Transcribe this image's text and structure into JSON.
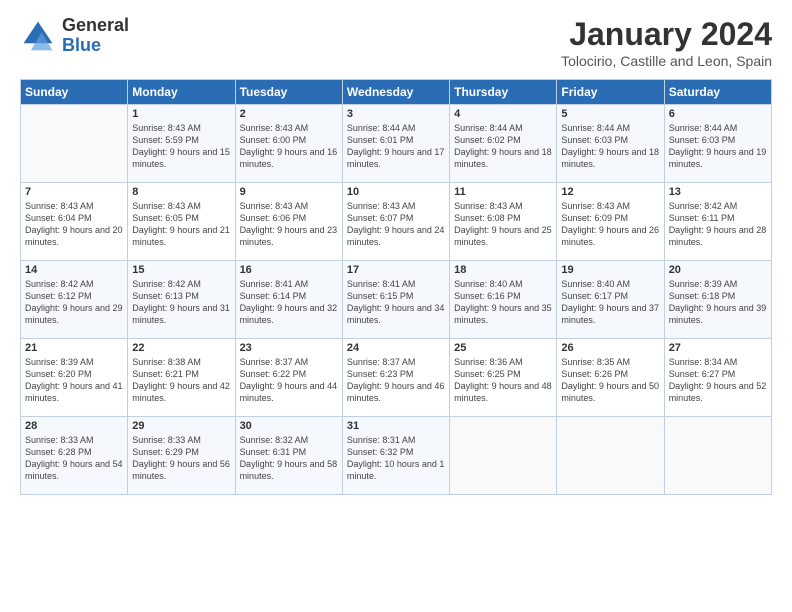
{
  "logo": {
    "general": "General",
    "blue": "Blue"
  },
  "header": {
    "month_year": "January 2024",
    "location": "Tolocirio, Castille and Leon, Spain"
  },
  "days_of_week": [
    "Sunday",
    "Monday",
    "Tuesday",
    "Wednesday",
    "Thursday",
    "Friday",
    "Saturday"
  ],
  "weeks": [
    [
      {
        "day": "",
        "sunrise": "",
        "sunset": "",
        "daylight": ""
      },
      {
        "day": "1",
        "sunrise": "Sunrise: 8:43 AM",
        "sunset": "Sunset: 5:59 PM",
        "daylight": "Daylight: 9 hours and 15 minutes."
      },
      {
        "day": "2",
        "sunrise": "Sunrise: 8:43 AM",
        "sunset": "Sunset: 6:00 PM",
        "daylight": "Daylight: 9 hours and 16 minutes."
      },
      {
        "day": "3",
        "sunrise": "Sunrise: 8:44 AM",
        "sunset": "Sunset: 6:01 PM",
        "daylight": "Daylight: 9 hours and 17 minutes."
      },
      {
        "day": "4",
        "sunrise": "Sunrise: 8:44 AM",
        "sunset": "Sunset: 6:02 PM",
        "daylight": "Daylight: 9 hours and 18 minutes."
      },
      {
        "day": "5",
        "sunrise": "Sunrise: 8:44 AM",
        "sunset": "Sunset: 6:03 PM",
        "daylight": "Daylight: 9 hours and 18 minutes."
      },
      {
        "day": "6",
        "sunrise": "Sunrise: 8:44 AM",
        "sunset": "Sunset: 6:03 PM",
        "daylight": "Daylight: 9 hours and 19 minutes."
      }
    ],
    [
      {
        "day": "7",
        "sunrise": "Sunrise: 8:43 AM",
        "sunset": "Sunset: 6:04 PM",
        "daylight": "Daylight: 9 hours and 20 minutes."
      },
      {
        "day": "8",
        "sunrise": "Sunrise: 8:43 AM",
        "sunset": "Sunset: 6:05 PM",
        "daylight": "Daylight: 9 hours and 21 minutes."
      },
      {
        "day": "9",
        "sunrise": "Sunrise: 8:43 AM",
        "sunset": "Sunset: 6:06 PM",
        "daylight": "Daylight: 9 hours and 23 minutes."
      },
      {
        "day": "10",
        "sunrise": "Sunrise: 8:43 AM",
        "sunset": "Sunset: 6:07 PM",
        "daylight": "Daylight: 9 hours and 24 minutes."
      },
      {
        "day": "11",
        "sunrise": "Sunrise: 8:43 AM",
        "sunset": "Sunset: 6:08 PM",
        "daylight": "Daylight: 9 hours and 25 minutes."
      },
      {
        "day": "12",
        "sunrise": "Sunrise: 8:43 AM",
        "sunset": "Sunset: 6:09 PM",
        "daylight": "Daylight: 9 hours and 26 minutes."
      },
      {
        "day": "13",
        "sunrise": "Sunrise: 8:42 AM",
        "sunset": "Sunset: 6:11 PM",
        "daylight": "Daylight: 9 hours and 28 minutes."
      }
    ],
    [
      {
        "day": "14",
        "sunrise": "Sunrise: 8:42 AM",
        "sunset": "Sunset: 6:12 PM",
        "daylight": "Daylight: 9 hours and 29 minutes."
      },
      {
        "day": "15",
        "sunrise": "Sunrise: 8:42 AM",
        "sunset": "Sunset: 6:13 PM",
        "daylight": "Daylight: 9 hours and 31 minutes."
      },
      {
        "day": "16",
        "sunrise": "Sunrise: 8:41 AM",
        "sunset": "Sunset: 6:14 PM",
        "daylight": "Daylight: 9 hours and 32 minutes."
      },
      {
        "day": "17",
        "sunrise": "Sunrise: 8:41 AM",
        "sunset": "Sunset: 6:15 PM",
        "daylight": "Daylight: 9 hours and 34 minutes."
      },
      {
        "day": "18",
        "sunrise": "Sunrise: 8:40 AM",
        "sunset": "Sunset: 6:16 PM",
        "daylight": "Daylight: 9 hours and 35 minutes."
      },
      {
        "day": "19",
        "sunrise": "Sunrise: 8:40 AM",
        "sunset": "Sunset: 6:17 PM",
        "daylight": "Daylight: 9 hours and 37 minutes."
      },
      {
        "day": "20",
        "sunrise": "Sunrise: 8:39 AM",
        "sunset": "Sunset: 6:18 PM",
        "daylight": "Daylight: 9 hours and 39 minutes."
      }
    ],
    [
      {
        "day": "21",
        "sunrise": "Sunrise: 8:39 AM",
        "sunset": "Sunset: 6:20 PM",
        "daylight": "Daylight: 9 hours and 41 minutes."
      },
      {
        "day": "22",
        "sunrise": "Sunrise: 8:38 AM",
        "sunset": "Sunset: 6:21 PM",
        "daylight": "Daylight: 9 hours and 42 minutes."
      },
      {
        "day": "23",
        "sunrise": "Sunrise: 8:37 AM",
        "sunset": "Sunset: 6:22 PM",
        "daylight": "Daylight: 9 hours and 44 minutes."
      },
      {
        "day": "24",
        "sunrise": "Sunrise: 8:37 AM",
        "sunset": "Sunset: 6:23 PM",
        "daylight": "Daylight: 9 hours and 46 minutes."
      },
      {
        "day": "25",
        "sunrise": "Sunrise: 8:36 AM",
        "sunset": "Sunset: 6:25 PM",
        "daylight": "Daylight: 9 hours and 48 minutes."
      },
      {
        "day": "26",
        "sunrise": "Sunrise: 8:35 AM",
        "sunset": "Sunset: 6:26 PM",
        "daylight": "Daylight: 9 hours and 50 minutes."
      },
      {
        "day": "27",
        "sunrise": "Sunrise: 8:34 AM",
        "sunset": "Sunset: 6:27 PM",
        "daylight": "Daylight: 9 hours and 52 minutes."
      }
    ],
    [
      {
        "day": "28",
        "sunrise": "Sunrise: 8:33 AM",
        "sunset": "Sunset: 6:28 PM",
        "daylight": "Daylight: 9 hours and 54 minutes."
      },
      {
        "day": "29",
        "sunrise": "Sunrise: 8:33 AM",
        "sunset": "Sunset: 6:29 PM",
        "daylight": "Daylight: 9 hours and 56 minutes."
      },
      {
        "day": "30",
        "sunrise": "Sunrise: 8:32 AM",
        "sunset": "Sunset: 6:31 PM",
        "daylight": "Daylight: 9 hours and 58 minutes."
      },
      {
        "day": "31",
        "sunrise": "Sunrise: 8:31 AM",
        "sunset": "Sunset: 6:32 PM",
        "daylight": "Daylight: 10 hours and 1 minute."
      },
      {
        "day": "",
        "sunrise": "",
        "sunset": "",
        "daylight": ""
      },
      {
        "day": "",
        "sunrise": "",
        "sunset": "",
        "daylight": ""
      },
      {
        "day": "",
        "sunrise": "",
        "sunset": "",
        "daylight": ""
      }
    ]
  ]
}
